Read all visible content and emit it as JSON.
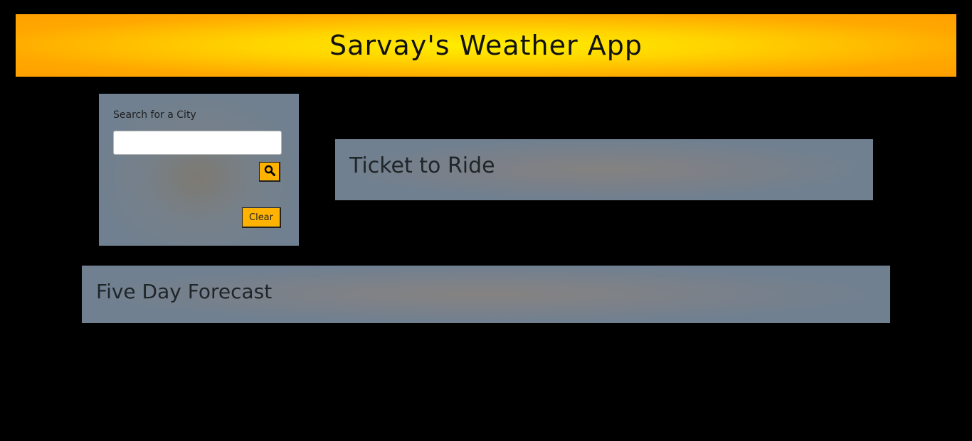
{
  "header": {
    "title": "Sarvay's Weather App"
  },
  "search": {
    "label": "Search for a City",
    "input_value": "",
    "placeholder": "",
    "search_icon": "search-icon",
    "clear_label": "Clear"
  },
  "current": {
    "title": "Ticket to Ride"
  },
  "forecast": {
    "title": "Five Day Forecast"
  },
  "colors": {
    "background": "#000000",
    "header_center": "#ffee00",
    "header_edge": "#ff9f00",
    "panel": "#708090",
    "button": "#ffb300"
  }
}
